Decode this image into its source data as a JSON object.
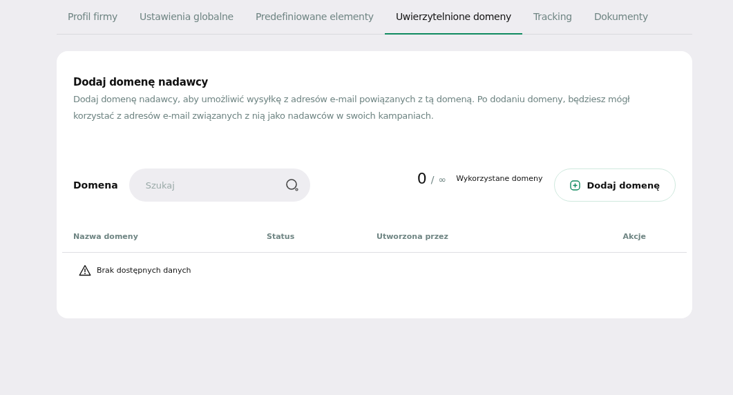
{
  "tabs": [
    {
      "label": "Profil firmy",
      "selected": false
    },
    {
      "label": "Ustawienia globalne",
      "selected": false
    },
    {
      "label": "Predefiniowane elementy",
      "selected": false
    },
    {
      "label": "Uwierzytelnione domeny",
      "selected": true
    },
    {
      "label": "Tracking",
      "selected": false
    },
    {
      "label": "Dokumenty",
      "selected": false
    }
  ],
  "section": {
    "title": "Dodaj domenę nadawcy",
    "description": "Dodaj domenę nadawcy, aby umożliwić wysyłkę z adresów e-mail powiązanych z tą domeną. Po dodaniu domeny, będziesz mógł korzystać z adresów e-mail związanych z nią jako nadawców w swoich kampaniach."
  },
  "filter": {
    "label": "Domena",
    "search": {
      "placeholder": "Szukaj"
    }
  },
  "usage": {
    "used": "0",
    "separator": "/",
    "limit": "∞",
    "label": "Wykorzystane domeny"
  },
  "add_button": {
    "label": "Dodaj domenę"
  },
  "table": {
    "columns": [
      "Nazwa domeny",
      "Status",
      "Utworzona przez",
      "Akcje"
    ],
    "empty_message": "Brak dostępnych danych"
  }
}
